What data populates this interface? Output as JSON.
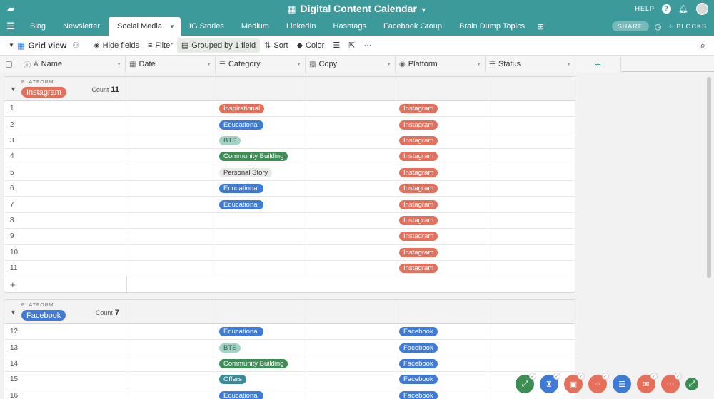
{
  "header": {
    "base_title": "Digital Content Calendar",
    "help_label": "HELP",
    "help_icon": "?"
  },
  "tabs": {
    "items": [
      "Blog",
      "Newsletter",
      "Social Media",
      "IG Stories",
      "Medium",
      "LinkedIn",
      "Hashtags",
      "Facebook Group",
      "Brain Dump Topics"
    ],
    "active": "Social Media",
    "share_label": "SHARE",
    "blocks_label": "BLOCKS"
  },
  "toolbar": {
    "view_name": "Grid view",
    "hide_fields": "Hide fields",
    "filter": "Filter",
    "grouped": "Grouped by 1 field",
    "sort": "Sort",
    "color": "Color"
  },
  "columns": {
    "name": "Name",
    "date": "Date",
    "category": "Category",
    "copy": "Copy",
    "platform": "Platform",
    "status": "Status"
  },
  "colors": {
    "header": "#3d9a9a",
    "instagram": "#e56f5a",
    "facebook": "#3f7bd6",
    "inspirational": "#e56f5a",
    "educational": "#3f7bd6",
    "bts": "#a3d3c4",
    "community_building": "#3e8d55",
    "personal_story": "#e9e9e9",
    "offers": "#3d8b98"
  },
  "groups": [
    {
      "field_label": "PLATFORM",
      "value": "Instagram",
      "count_label": "Count",
      "count": "11",
      "rows": [
        {
          "num": "1",
          "category": "Inspirational",
          "platform": "Instagram"
        },
        {
          "num": "2",
          "category": "Educational",
          "platform": "Instagram"
        },
        {
          "num": "3",
          "category": "BTS",
          "platform": "Instagram"
        },
        {
          "num": "4",
          "category": "Community Building",
          "platform": "Instagram"
        },
        {
          "num": "5",
          "category": "Personal Story",
          "platform": "Instagram"
        },
        {
          "num": "6",
          "category": "Educational",
          "platform": "Instagram"
        },
        {
          "num": "7",
          "category": "Educational",
          "platform": "Instagram"
        },
        {
          "num": "8",
          "category": "",
          "platform": "Instagram"
        },
        {
          "num": "9",
          "category": "",
          "platform": "Instagram"
        },
        {
          "num": "10",
          "category": "",
          "platform": "Instagram"
        },
        {
          "num": "11",
          "category": "",
          "platform": "Instagram"
        }
      ]
    },
    {
      "field_label": "PLATFORM",
      "value": "Facebook",
      "count_label": "Count",
      "count": "7",
      "rows": [
        {
          "num": "12",
          "category": "Educational",
          "platform": "Facebook"
        },
        {
          "num": "13",
          "category": "BTS",
          "platform": "Facebook"
        },
        {
          "num": "14",
          "category": "Community Building",
          "platform": "Facebook"
        },
        {
          "num": "15",
          "category": "Offers",
          "platform": "Facebook"
        },
        {
          "num": "16",
          "category": "Educational",
          "platform": "Facebook"
        }
      ]
    }
  ],
  "apps": [
    "#3e8d55",
    "#3f7bd6",
    "#e56f5a",
    "#e56f5a",
    "#3f7bd6",
    "#e56f5a",
    "#e56f5a",
    "#3e8d55"
  ]
}
